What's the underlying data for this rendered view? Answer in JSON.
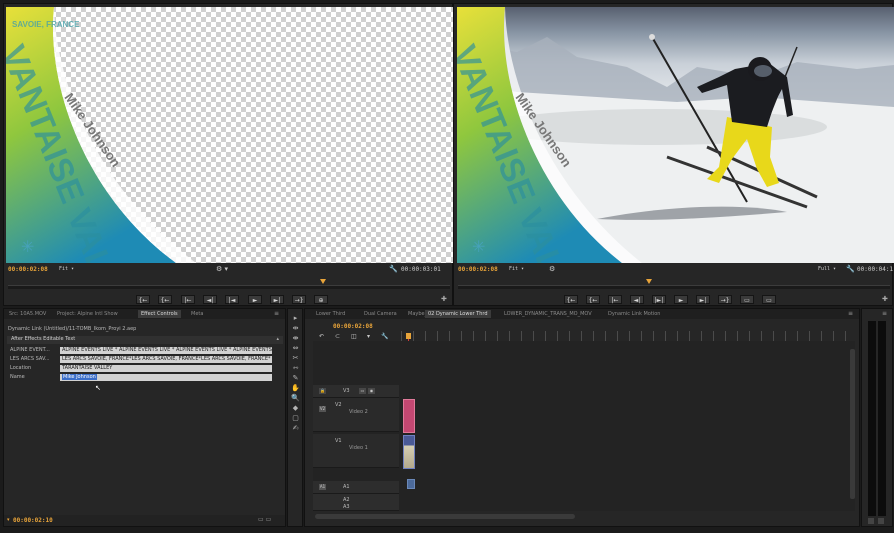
{
  "source_monitor": {
    "timecode": "00:00:02:08",
    "zoom": "Fit",
    "duration": "00:00:03:01",
    "graphic_texts": [
      "VANTAISE VALLEY",
      "Mike Johnson"
    ]
  },
  "program_monitor": {
    "timecode": "00:00:02:08",
    "zoom": "Fit",
    "quality": "Full",
    "duration": "00:00:04:1",
    "graphic_texts": [
      "VANTAISE VALLEY",
      "Mike Johnson"
    ]
  },
  "transport_buttons": [
    "{←",
    "{←",
    "|←",
    "◄|",
    "|◄",
    "►",
    "►|",
    "→}",
    "⊕"
  ],
  "program_transport_buttons": [
    "{←",
    "{←",
    "|←",
    "◄|",
    "|►|",
    "►",
    "►|",
    "→}",
    "▭",
    "▭"
  ],
  "effect_controls": {
    "tabs": [
      "Src: 10A5.MOV",
      "Project: Alpine Intl Show",
      "Effect Controls",
      "Meta"
    ],
    "clip_path": "Dynamic Link (Untitled)/11-TOMB_Ikom_Proyi 2.aep",
    "section": "After Effects Editable Text",
    "properties": [
      {
        "label": "ALPINE EVENT...",
        "value": "ALPINE EVENTS LIVE * ALPINE EVENTS LIVE * ALPINE EVENTS LIVE * ALPINE EVENTS LI"
      },
      {
        "label": "LES ARCS SAV...",
        "value": "LES ARCS SAVOIE, FRANCE*LES ARCS SAVOIE, FRANCE*LES ARCS SAVOIE, FRANCE*"
      },
      {
        "label": "Location",
        "value": "TARANTAISE VALLEY"
      },
      {
        "label": "Name",
        "value": "Mike Johnson"
      }
    ],
    "bottom_timecode": "00:00:02:10"
  },
  "timeline": {
    "tabs": [
      "Lower Third",
      "Dual Camera",
      "Maybe_ComposiTarget",
      "02 Dynamic Lower Thrd",
      "LOWER_DYNAMIC_TRANS_MO_MOV",
      "Dynamic Link Motion"
    ],
    "timecode": "00:00:02:08",
    "tracks": [
      {
        "name": "V3",
        "label": "V3"
      },
      {
        "name": "V2",
        "label": "V2"
      },
      {
        "name": "V1",
        "label": "V1"
      },
      {
        "name": "A1",
        "label": "A1"
      },
      {
        "name": "A2",
        "label": "A2"
      },
      {
        "name": "A3",
        "label": "A3"
      }
    ],
    "track_subtitles": [
      "Video 2",
      "Video 1"
    ]
  },
  "tools": [
    "▸",
    "⇹",
    "⇼",
    "⇔",
    "✂",
    "⇿",
    "✎",
    "✋",
    "🔍",
    "◆",
    "▢",
    "✍"
  ],
  "colors": {
    "timecode": "#e8a43a",
    "playhead": "#e8a43a",
    "clip_pink": "#c44872",
    "clip_blue": "#4a5a96",
    "clip_red": "#d13030",
    "graphic_green": "#8fc73e",
    "graphic_blue": "#1e8bb5"
  }
}
